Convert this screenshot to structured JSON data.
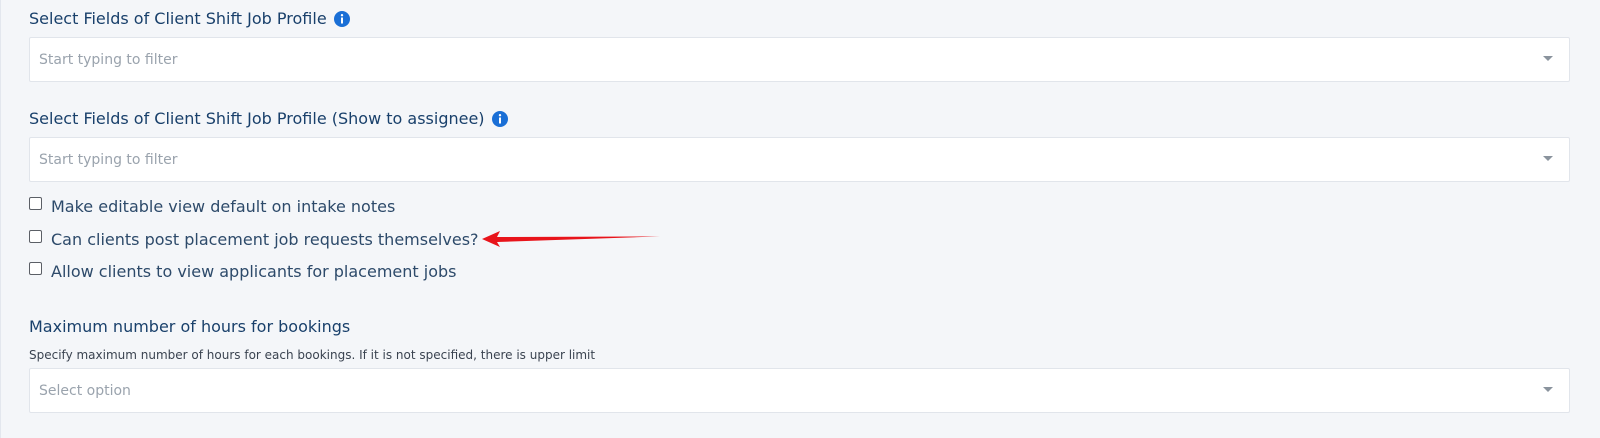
{
  "profile_fields": {
    "label": "Select Fields of Client Shift Job Profile",
    "info_icon": "info-icon",
    "placeholder": "Start typing to filter"
  },
  "assignee_fields": {
    "label": "Select Fields of Client Shift Job Profile (Show to assignee)",
    "info_icon": "info-icon",
    "placeholder": "Start typing to filter"
  },
  "checkboxes": [
    {
      "label": "Make editable view default on intake notes",
      "checked": false
    },
    {
      "label": "Can clients post placement job requests themselves?",
      "checked": false
    },
    {
      "label": "Allow clients to view applicants for placement jobs",
      "checked": false
    }
  ],
  "max_hours": {
    "title": "Maximum number of hours for bookings",
    "helper": "Specify maximum number of hours for each bookings. If it is not specified, there is upper limit",
    "placeholder": "Select option"
  },
  "colors": {
    "label": "#19406b",
    "info": "#1a6fd6",
    "annotation_arrow": "#e8141b",
    "background": "#f4f6f9"
  }
}
